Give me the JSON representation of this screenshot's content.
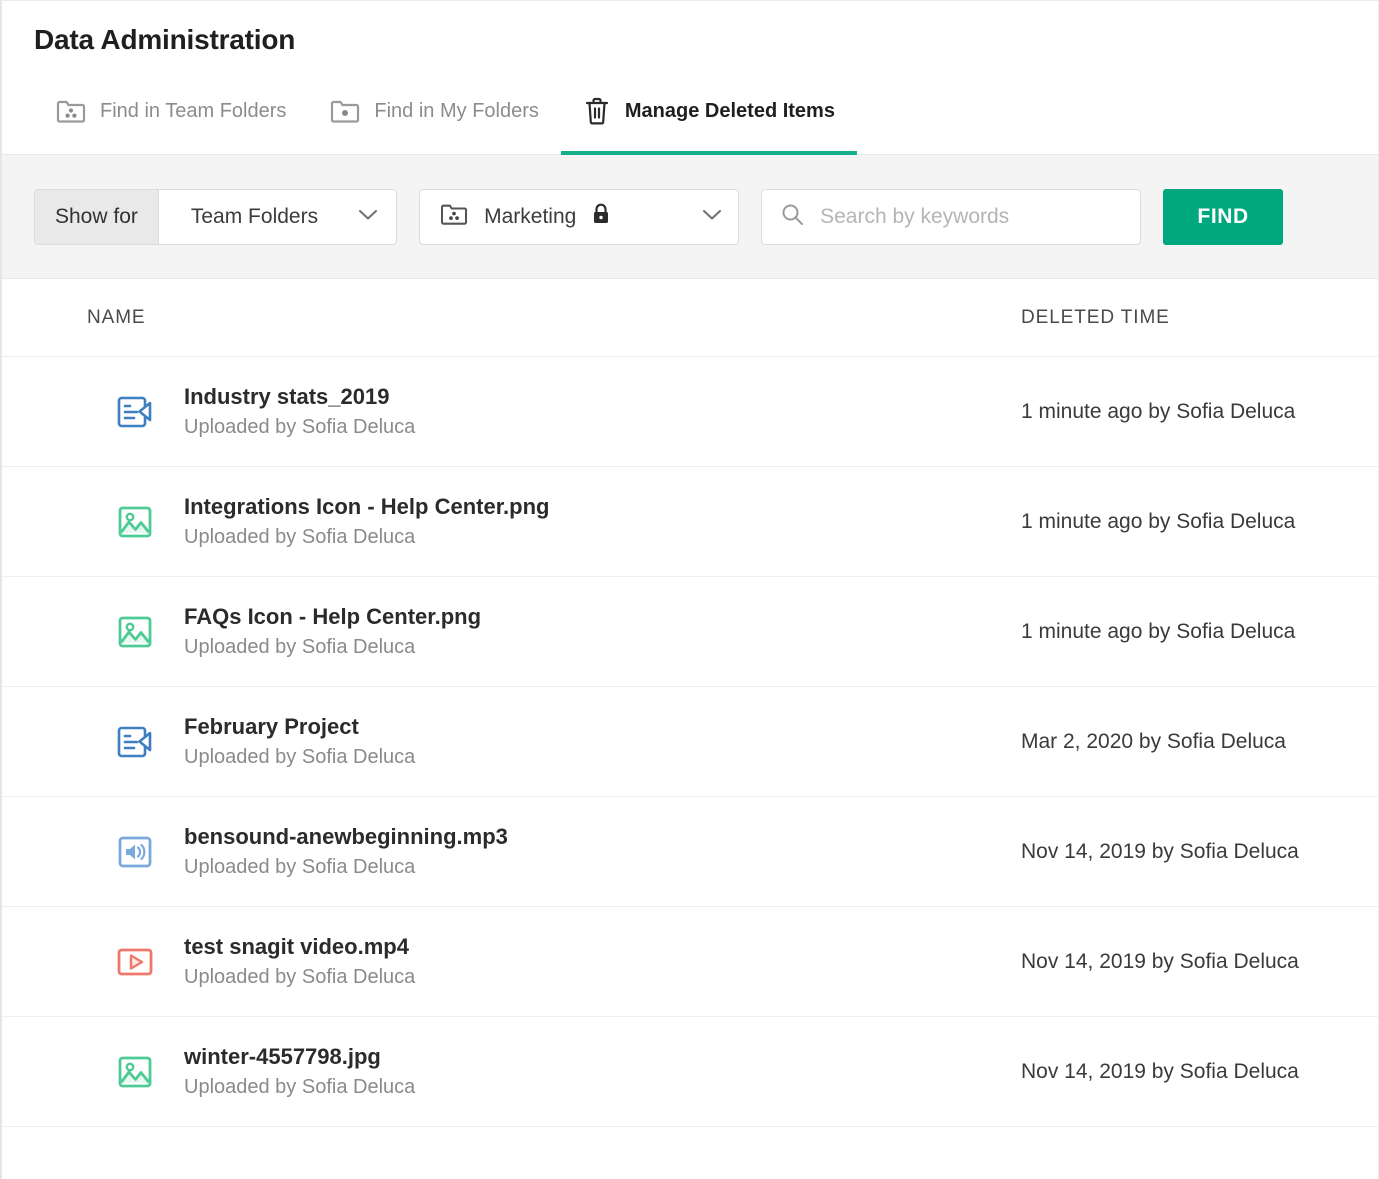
{
  "header": {
    "title": "Data Administration"
  },
  "tabs": [
    {
      "label": "Find in Team Folders",
      "icon": "team-folder-icon",
      "active": false
    },
    {
      "label": "Find in My Folders",
      "icon": "my-folder-icon",
      "active": false
    },
    {
      "label": "Manage Deleted Items",
      "icon": "trash-icon",
      "active": true
    }
  ],
  "filterbar": {
    "show_for_label": "Show for",
    "scope_value": "Team Folders",
    "folder_value": "Marketing",
    "folder_icon": "team-folder-icon",
    "folder_locked_icon": "lock-icon",
    "search_placeholder": "Search by keywords",
    "search_value": "",
    "search_icon": "search-icon",
    "find_label": "FIND"
  },
  "table": {
    "columns": [
      "NAME",
      "DELETED TIME"
    ],
    "rows": [
      {
        "icon": "document-icon",
        "name": "Industry stats_2019",
        "sub": "Uploaded by Sofia Deluca",
        "time": "1 minute ago by Sofia Deluca"
      },
      {
        "icon": "image-icon",
        "name": "Integrations Icon - Help Center.png",
        "sub": "Uploaded by Sofia Deluca",
        "time": "1 minute ago by Sofia Deluca"
      },
      {
        "icon": "image-icon",
        "name": "FAQs Icon - Help Center.png",
        "sub": "Uploaded by Sofia Deluca",
        "time": "1 minute ago by Sofia Deluca"
      },
      {
        "icon": "document-icon",
        "name": "February Project",
        "sub": "Uploaded by Sofia Deluca",
        "time": "Mar 2, 2020 by Sofia Deluca"
      },
      {
        "icon": "audio-icon",
        "name": "bensound-anewbeginning.mp3",
        "sub": "Uploaded by Sofia Deluca",
        "time": "Nov 14, 2019 by Sofia Deluca"
      },
      {
        "icon": "video-icon",
        "name": "test snagit video.mp4",
        "sub": "Uploaded by Sofia Deluca",
        "time": "Nov 14, 2019 by Sofia Deluca"
      },
      {
        "icon": "image-icon",
        "name": "winter-4557798.jpg",
        "sub": "Uploaded by Sofia Deluca",
        "time": "Nov 14, 2019 by Sofia Deluca"
      }
    ]
  },
  "colors": {
    "accent_teal": "#00a87e",
    "tab_underline": "#14b08a",
    "document_blue": "#3d7fc1",
    "image_green": "#4ecb95",
    "audio_blue": "#7aa9dd",
    "video_red": "#f0776c"
  }
}
